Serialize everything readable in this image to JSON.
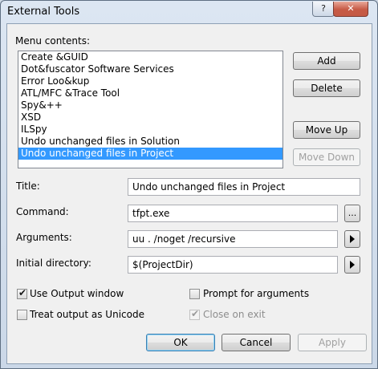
{
  "window": {
    "title": "External Tools",
    "help_label": "?",
    "close_label": "✕"
  },
  "menu": {
    "label": "Menu contents:",
    "items": [
      {
        "label": "Create &GUID",
        "selected": false
      },
      {
        "label": "Dot&fuscator Software Services",
        "selected": false
      },
      {
        "label": "Error Loo&kup",
        "selected": false
      },
      {
        "label": "ATL/MFC &Trace Tool",
        "selected": false
      },
      {
        "label": "Spy&++",
        "selected": false
      },
      {
        "label": "XSD",
        "selected": false
      },
      {
        "label": "ILSpy",
        "selected": false
      },
      {
        "label": "Undo unchanged files in Solution",
        "selected": false
      },
      {
        "label": "Undo unchanged files in Project",
        "selected": true
      }
    ]
  },
  "buttons": {
    "add": "Add",
    "delete": "Delete",
    "move_up": "Move Up",
    "move_down": "Move Down",
    "ok": "OK",
    "cancel": "Cancel",
    "apply": "Apply"
  },
  "fields": {
    "title_label": "Title:",
    "title_value": "Undo unchanged files in Project",
    "command_label": "Command:",
    "command_value": "tfpt.exe",
    "browse_label": "...",
    "arguments_label": "Arguments:",
    "arguments_value": "uu . /noget /recursive",
    "initial_dir_label": "Initial directory:",
    "initial_dir_value": "$(ProjectDir)"
  },
  "options": {
    "use_output": {
      "label": "Use Output window",
      "checked": true,
      "enabled": true
    },
    "prompt_args": {
      "label": "Prompt for arguments",
      "checked": false,
      "enabled": true
    },
    "unicode": {
      "label": "Treat output as Unicode",
      "checked": false,
      "enabled": true
    },
    "close_on_exit": {
      "label": "Close on exit",
      "checked": true,
      "enabled": false
    }
  }
}
